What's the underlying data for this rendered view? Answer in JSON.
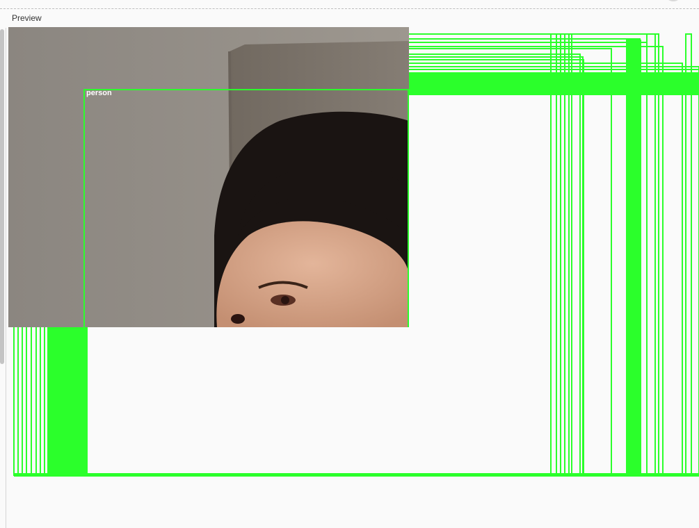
{
  "panel": {
    "title": "Preview"
  },
  "detection": {
    "label": "person",
    "color": "#2bff2b"
  },
  "camera_feed": {
    "description_icon": "webcam-frame",
    "wall_color": "#8e8983",
    "hair_color": "#1a1412",
    "skin_color": "#d9a98c"
  }
}
